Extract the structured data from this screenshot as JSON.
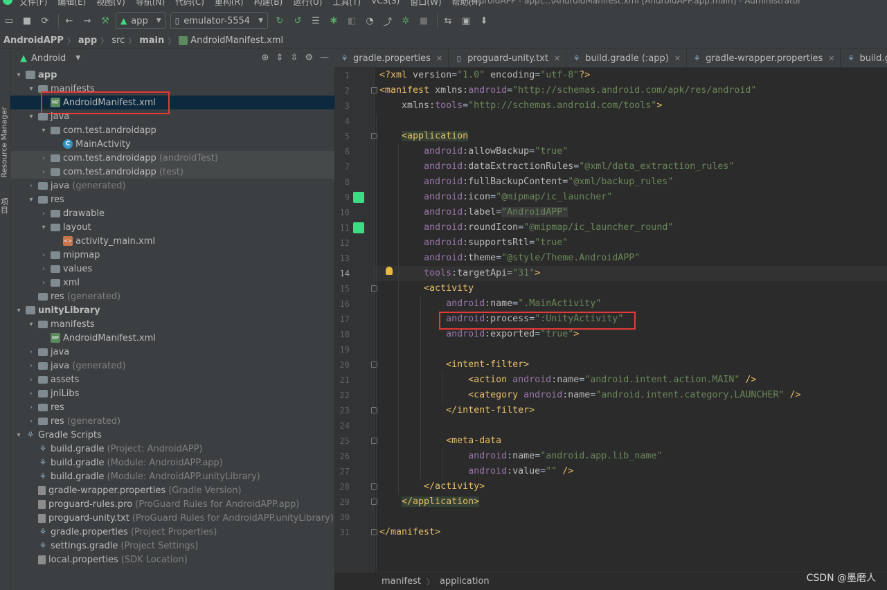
{
  "menubar": {
    "items": [
      "文件(F)",
      "编辑(E)",
      "视图(V)",
      "导航(N)",
      "代码(C)",
      "重构(R)",
      "构建(B)",
      "运行(U)",
      "工具(T)",
      "VCS(S)",
      "窗口(W)",
      "帮助(H)"
    ],
    "window_title": "AndroidAPP - app\\...\\AndroidManifest.xml [AndroidAPP.app.main] - Administrator"
  },
  "toolbar": {
    "config_label": "app",
    "device_label": "emulator-5554"
  },
  "breadcrumb": {
    "items": [
      "AndroidAPP",
      "app",
      "src",
      "main",
      "AndroidManifest.xml"
    ]
  },
  "left_strip": {
    "resource_manager": "Resource Manager",
    "project": "项目"
  },
  "project_panel": {
    "view_label": "Android",
    "tree": [
      {
        "label": "app",
        "sub": ""
      },
      {
        "label": "manifests",
        "sub": ""
      },
      {
        "label": "AndroidManifest.xml",
        "sub": ""
      },
      {
        "label": "java",
        "sub": ""
      },
      {
        "label": "com.test.androidapp",
        "sub": ""
      },
      {
        "label": "MainActivity",
        "sub": ""
      },
      {
        "label": "com.test.androidapp",
        "sub": "(androidTest)"
      },
      {
        "label": "com.test.androidapp",
        "sub": "(test)"
      },
      {
        "label": "java",
        "sub": "(generated)"
      },
      {
        "label": "res",
        "sub": ""
      },
      {
        "label": "drawable",
        "sub": ""
      },
      {
        "label": "layout",
        "sub": ""
      },
      {
        "label": "activity_main.xml",
        "sub": ""
      },
      {
        "label": "mipmap",
        "sub": ""
      },
      {
        "label": "values",
        "sub": ""
      },
      {
        "label": "xml",
        "sub": ""
      },
      {
        "label": "res",
        "sub": "(generated)"
      },
      {
        "label": "unityLibrary",
        "sub": ""
      },
      {
        "label": "manifests",
        "sub": ""
      },
      {
        "label": "AndroidManifest.xml",
        "sub": ""
      },
      {
        "label": "java",
        "sub": ""
      },
      {
        "label": "java",
        "sub": "(generated)"
      },
      {
        "label": "assets",
        "sub": ""
      },
      {
        "label": "jniLibs",
        "sub": ""
      },
      {
        "label": "res",
        "sub": ""
      },
      {
        "label": "res",
        "sub": "(generated)"
      },
      {
        "label": "Gradle Scripts",
        "sub": ""
      },
      {
        "label": "build.gradle",
        "sub": "(Project: AndroidAPP)"
      },
      {
        "label": "build.gradle",
        "sub": "(Module: AndroidAPP.app)"
      },
      {
        "label": "build.gradle",
        "sub": "(Module: AndroidAPP.unityLibrary)"
      },
      {
        "label": "gradle-wrapper.properties",
        "sub": "(Gradle Version)"
      },
      {
        "label": "proguard-rules.pro",
        "sub": "(ProGuard Rules for AndroidAPP.app)"
      },
      {
        "label": "proguard-unity.txt",
        "sub": "(ProGuard Rules for AndroidAPP.unityLibrary)"
      },
      {
        "label": "gradle.properties",
        "sub": "(Project Properties)"
      },
      {
        "label": "settings.gradle",
        "sub": "(Project Settings)"
      },
      {
        "label": "local.properties",
        "sub": "(SDK Location)"
      }
    ]
  },
  "tabs": [
    "gradle.properties",
    "proguard-unity.txt",
    "build.gradle (:app)",
    "gradle-wrapper.properties",
    "build.gradle (:uni"
  ],
  "editor": {
    "line_numbers": [
      "1",
      "2",
      "3",
      "4",
      "5",
      "6",
      "7",
      "8",
      "9",
      "10",
      "11",
      "12",
      "13",
      "14",
      "15",
      "16",
      "17",
      "18",
      "19",
      "20",
      "21",
      "22",
      "23",
      "24",
      "25",
      "26",
      "27",
      "28",
      "29",
      "30",
      "31"
    ],
    "current_line": "14"
  },
  "editor_crumb": [
    "manifest",
    "application"
  ],
  "watermark": "CSDN @墨磨人"
}
